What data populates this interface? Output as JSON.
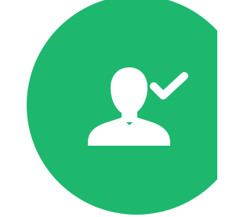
{
  "badge": {
    "icon": "user-check-icon",
    "background_color": "#1db86e",
    "glyph_color": "#ffffff"
  }
}
